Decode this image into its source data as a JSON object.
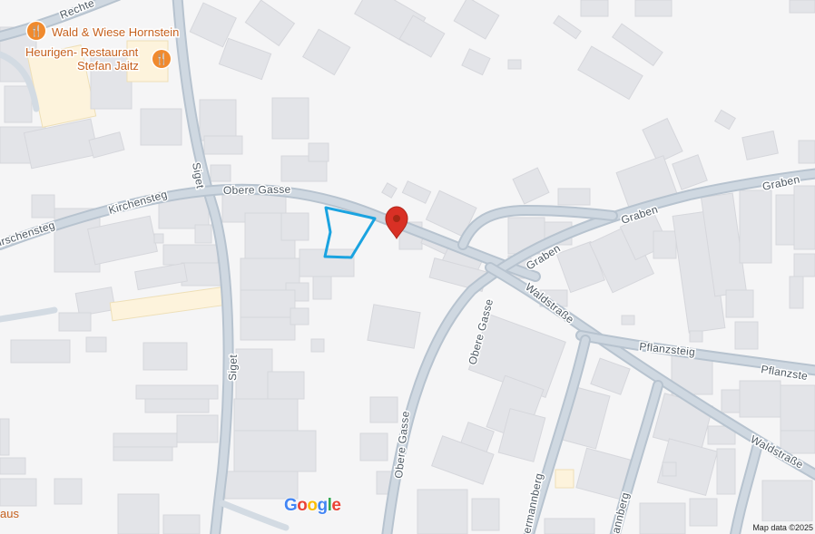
{
  "streets": {
    "rechte": "Rechte",
    "kirschensteg_left": "Kirschensteg",
    "kirchensteg": "Kirchensteg",
    "obere_gasse_top": "Obere Gasse",
    "siget_top": "Siget",
    "siget_bottom": "Siget",
    "graben_right": "Graben",
    "graben_mid": "Graben",
    "graben_low": "Graben",
    "obere_gasse_mid": "Obere Gasse",
    "obere_gasse_bottom": "Obere Gasse",
    "waldstrasse_mid": "Waldstraße",
    "waldstrasse_right": "Waldstraße",
    "pflanzsteig": "Pflanzsteig",
    "pflanzsteig_right": "Pflanzste",
    "hermannberg": "ermannberg",
    "annberg": "annberg"
  },
  "pois": {
    "restaurant1": {
      "name": "Wald & Wiese Hornstein",
      "icon": "restaurant-icon"
    },
    "restaurant2": {
      "line1": "Heurigen- Restaurant",
      "line2": "Stefan Jaitz",
      "icon": "restaurant-icon"
    }
  },
  "edge_text": "aus",
  "marker": {
    "icon": "map-pin-icon",
    "color": "#d93025"
  },
  "parcel_outline_color": "#1aa3e0",
  "branding": {
    "logo": "Google"
  },
  "attribution": "Map data ©2025",
  "colors": {
    "road": "#b7c3cf",
    "building": "#e3e4e8",
    "background": "#f5f5f6",
    "poi": "#f08a2e"
  }
}
